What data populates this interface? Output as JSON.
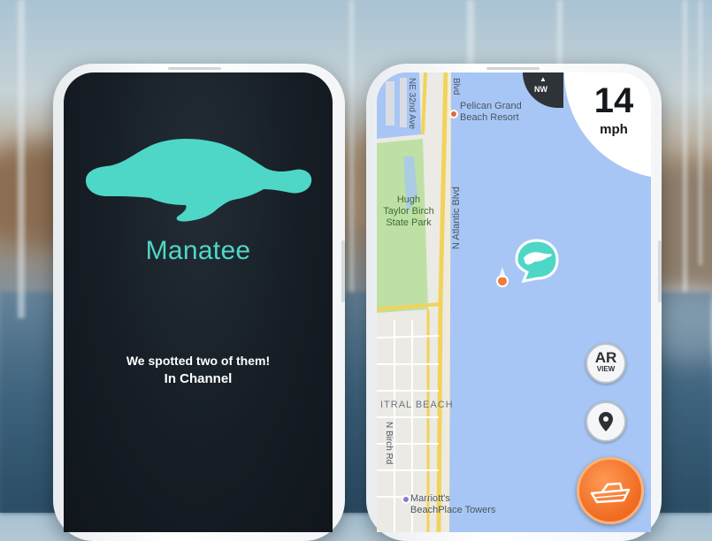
{
  "left_screen": {
    "species": "Manatee",
    "message": "We spotted two of them!",
    "location": "In Channel",
    "accent_color": "#4ed7c6"
  },
  "right_screen": {
    "compass_direction": "NW",
    "speed": "14",
    "speed_unit": "mph",
    "map_labels": {
      "road_ne32": "NE 32nd Ave",
      "road_blvd_top": "Blvd",
      "road_atlantic": "N Atlantic Blvd",
      "road_birch": "N Birch Rd",
      "park": "Hugh Taylor Birch State Park",
      "park_line1": "Hugh",
      "park_line2": "Taylor Birch",
      "park_line3": "State Park",
      "hotel1_line1": "Pelican Grand",
      "hotel1_line2": "Beach Resort",
      "area": "ITRAL BEACH",
      "hotel2_line1": "Marriott's",
      "hotel2_line2": "BeachPlace Towers"
    },
    "buttons": {
      "ar_main": "AR",
      "ar_sub": "VIEW",
      "location_icon": "map-pin-icon",
      "boat_icon": "boat-icon"
    },
    "colors": {
      "water": "#a8c6f5",
      "road": "#f2d35a",
      "park": "#bfe0a4",
      "land": "#eceae4",
      "boat_button": "#f06a1f"
    }
  }
}
